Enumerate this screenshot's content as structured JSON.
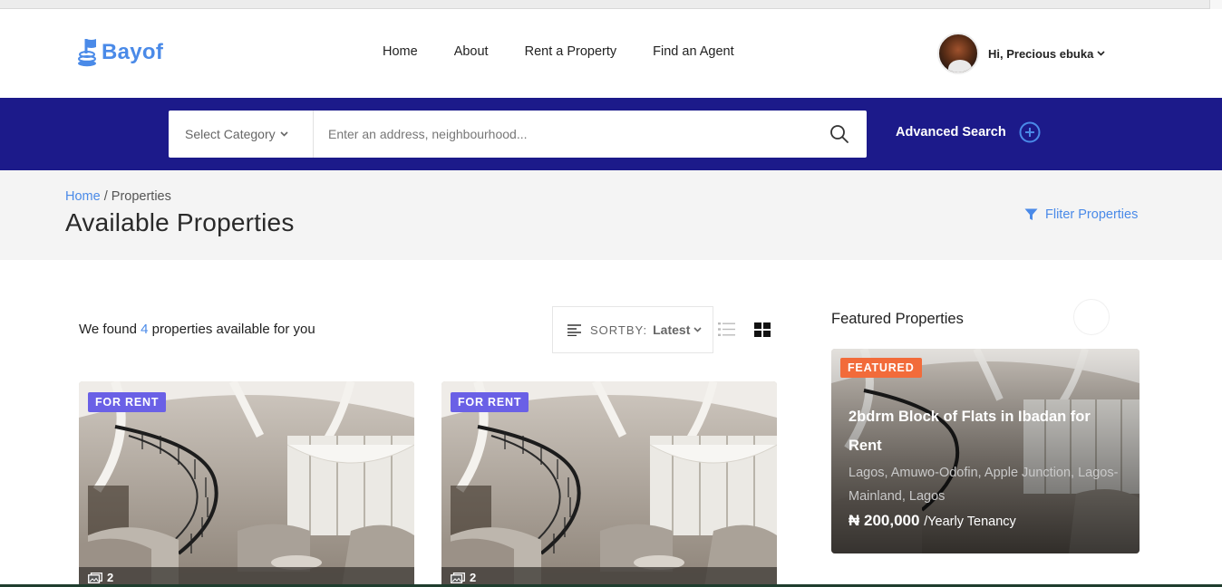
{
  "header": {
    "logo_text": "Bayof",
    "nav": [
      "Home",
      "About",
      "Rent a Property",
      "Find an Agent"
    ],
    "user_greeting": "Hi, Precious ebuka"
  },
  "search": {
    "category_label": "Select Category",
    "placeholder": "Enter an address, neighbourhood...",
    "advanced_label": "Advanced Search"
  },
  "breadcrumb": {
    "home": "Home",
    "separator": "/",
    "current": "Properties"
  },
  "page_title": "Available Properties",
  "filter_label": "Fliter Properties",
  "results": {
    "prefix": "We found",
    "count": "4",
    "suffix": "properties available for you",
    "sort_label": "SORTBY:",
    "sort_value": "Latest"
  },
  "cards": [
    {
      "badge": "FOR RENT",
      "photos": "2"
    },
    {
      "badge": "FOR RENT",
      "photos": "2"
    }
  ],
  "featured": {
    "heading": "Featured Properties",
    "badge": "FEATURED",
    "title": "2bdrm Block of Flats in Ibadan for Rent",
    "location": "Lagos, Amuwo-Odofin, Apple Junction, Lagos-Mainland, Lagos",
    "price": "₦ 200,000",
    "period": "/Yearly Tenancy"
  },
  "colors": {
    "brand": "#4a8ae8",
    "band": "#1c1a8a",
    "rent_badge": "#6a60e6",
    "featured_badge": "#f26b3a"
  }
}
